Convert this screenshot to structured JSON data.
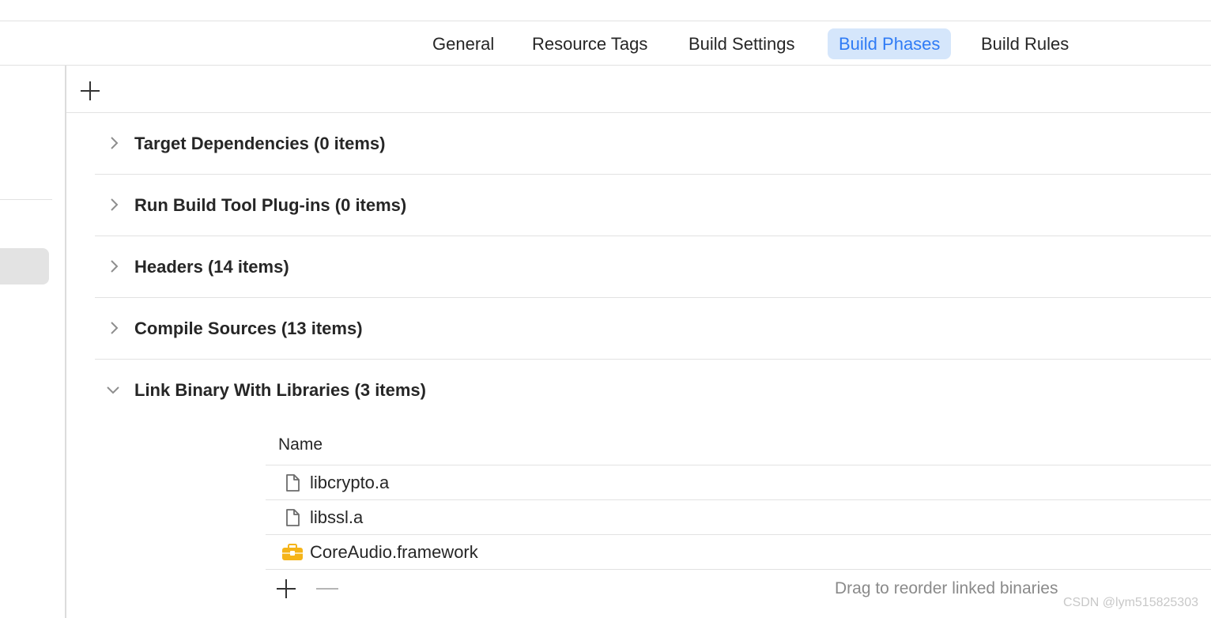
{
  "tabs": [
    {
      "label": "General",
      "active": false
    },
    {
      "label": "Resource Tags",
      "active": false
    },
    {
      "label": "Build Settings",
      "active": false
    },
    {
      "label": "Build Phases",
      "active": true
    },
    {
      "label": "Build Rules",
      "active": false
    }
  ],
  "phases": [
    {
      "title": "Target Dependencies (0 items)",
      "expanded": false
    },
    {
      "title": "Run Build Tool Plug-ins (0 items)",
      "expanded": false
    },
    {
      "title": "Headers (14 items)",
      "expanded": false
    },
    {
      "title": "Compile Sources (13 items)",
      "expanded": false
    },
    {
      "title": "Link Binary With Libraries (3 items)",
      "expanded": true
    }
  ],
  "libraries": {
    "column_name": "Name",
    "items": [
      {
        "name": "libcrypto.a",
        "icon": "file-icon"
      },
      {
        "name": "libssl.a",
        "icon": "file-icon"
      },
      {
        "name": "CoreAudio.framework",
        "icon": "toolbox-icon"
      }
    ],
    "hint": "Drag to reorder linked binaries"
  },
  "watermark": "CSDN @lym515825303",
  "colors": {
    "accent": "#2f7bf5",
    "selected_tab_bg": "#d5e6fb",
    "framework_icon": "#f5b418"
  }
}
